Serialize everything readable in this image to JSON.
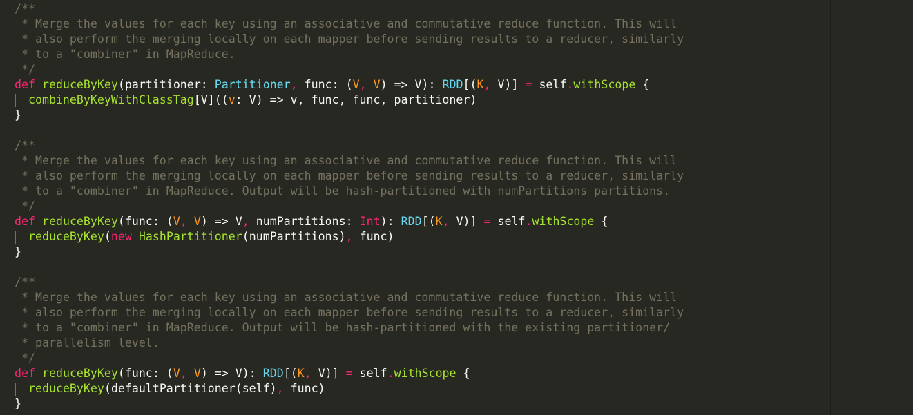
{
  "colors": {
    "background": "#272822",
    "keyword": "#f92672",
    "function": "#a6e22e",
    "type": "#66d9ef",
    "type_param": "#fd971f",
    "comment": "#75715e",
    "plain": "#f8f8f2"
  },
  "lines": [
    {
      "guide": false,
      "tokens": [
        {
          "c": "cm",
          "t": "/**"
        }
      ]
    },
    {
      "guide": false,
      "tokens": [
        {
          "c": "cm",
          "t": " * Merge the values for each key using an associative and commutative reduce function. This will"
        }
      ]
    },
    {
      "guide": false,
      "tokens": [
        {
          "c": "cm",
          "t": " * also perform the merging locally on each mapper before sending results to a reducer, similarly"
        }
      ]
    },
    {
      "guide": false,
      "tokens": [
        {
          "c": "cm",
          "t": " * to a \"combiner\" in MapReduce."
        }
      ]
    },
    {
      "guide": false,
      "tokens": [
        {
          "c": "cm",
          "t": " */"
        }
      ]
    },
    {
      "guide": false,
      "tokens": [
        {
          "c": "kw",
          "t": "def"
        },
        {
          "c": "pl",
          "t": " "
        },
        {
          "c": "fn",
          "t": "reduceByKey"
        },
        {
          "c": "pl",
          "t": "(partitioner: "
        },
        {
          "c": "ty",
          "t": "Partitioner"
        },
        {
          "c": "kw",
          "t": ","
        },
        {
          "c": "pl",
          "t": " func: ("
        },
        {
          "c": "tp",
          "t": "V"
        },
        {
          "c": "kw",
          "t": ","
        },
        {
          "c": "pl",
          "t": " "
        },
        {
          "c": "tp",
          "t": "V"
        },
        {
          "c": "pl",
          "t": ") => V): "
        },
        {
          "c": "ty",
          "t": "RDD"
        },
        {
          "c": "pl",
          "t": "[("
        },
        {
          "c": "tp",
          "t": "K"
        },
        {
          "c": "kw",
          "t": ","
        },
        {
          "c": "pl",
          "t": " V)] "
        },
        {
          "c": "kw",
          "t": "="
        },
        {
          "c": "pl",
          "t": " self"
        },
        {
          "c": "kw",
          "t": "."
        },
        {
          "c": "fn",
          "t": "withScope"
        },
        {
          "c": "pl",
          "t": " {"
        }
      ]
    },
    {
      "guide": true,
      "tokens": [
        {
          "c": "pl",
          "t": "  "
        },
        {
          "c": "fn",
          "t": "combineByKeyWithClassTag"
        },
        {
          "c": "pl",
          "t": "[V](("
        },
        {
          "c": "tp",
          "t": "v"
        },
        {
          "c": "pl",
          "t": ": V) => v, func, func, partitioner)"
        }
      ]
    },
    {
      "guide": false,
      "tokens": [
        {
          "c": "pl",
          "t": "}"
        }
      ]
    },
    {
      "guide": false,
      "tokens": [
        {
          "c": "pl",
          "t": ""
        }
      ]
    },
    {
      "guide": false,
      "tokens": [
        {
          "c": "cm",
          "t": "/**"
        }
      ]
    },
    {
      "guide": false,
      "tokens": [
        {
          "c": "cm",
          "t": " * Merge the values for each key using an associative and commutative reduce function. This will"
        }
      ]
    },
    {
      "guide": false,
      "tokens": [
        {
          "c": "cm",
          "t": " * also perform the merging locally on each mapper before sending results to a reducer, similarly"
        }
      ]
    },
    {
      "guide": false,
      "tokens": [
        {
          "c": "cm",
          "t": " * to a \"combiner\" in MapReduce. Output will be hash-partitioned with numPartitions partitions."
        }
      ]
    },
    {
      "guide": false,
      "tokens": [
        {
          "c": "cm",
          "t": " */"
        }
      ]
    },
    {
      "guide": false,
      "tokens": [
        {
          "c": "kw",
          "t": "def"
        },
        {
          "c": "pl",
          "t": " "
        },
        {
          "c": "fn",
          "t": "reduceByKey"
        },
        {
          "c": "pl",
          "t": "(func: ("
        },
        {
          "c": "tp",
          "t": "V"
        },
        {
          "c": "kw",
          "t": ","
        },
        {
          "c": "pl",
          "t": " "
        },
        {
          "c": "tp",
          "t": "V"
        },
        {
          "c": "pl",
          "t": ") => V"
        },
        {
          "c": "kw",
          "t": ","
        },
        {
          "c": "pl",
          "t": " numPartitions: "
        },
        {
          "c": "kw",
          "t": "Int"
        },
        {
          "c": "pl",
          "t": "): "
        },
        {
          "c": "ty",
          "t": "RDD"
        },
        {
          "c": "pl",
          "t": "[("
        },
        {
          "c": "tp",
          "t": "K"
        },
        {
          "c": "kw",
          "t": ","
        },
        {
          "c": "pl",
          "t": " V)] "
        },
        {
          "c": "kw",
          "t": "="
        },
        {
          "c": "pl",
          "t": " self"
        },
        {
          "c": "kw",
          "t": "."
        },
        {
          "c": "fn",
          "t": "withScope"
        },
        {
          "c": "pl",
          "t": " {"
        }
      ]
    },
    {
      "guide": true,
      "tokens": [
        {
          "c": "pl",
          "t": "  "
        },
        {
          "c": "fn",
          "t": "reduceByKey"
        },
        {
          "c": "pl",
          "t": "("
        },
        {
          "c": "kw",
          "t": "new"
        },
        {
          "c": "pl",
          "t": " "
        },
        {
          "c": "fn",
          "t": "HashPartitioner"
        },
        {
          "c": "pl",
          "t": "(numPartitions)"
        },
        {
          "c": "kw",
          "t": ","
        },
        {
          "c": "pl",
          "t": " func)"
        }
      ]
    },
    {
      "guide": false,
      "tokens": [
        {
          "c": "pl",
          "t": "}"
        }
      ]
    },
    {
      "guide": false,
      "tokens": [
        {
          "c": "pl",
          "t": ""
        }
      ]
    },
    {
      "guide": false,
      "tokens": [
        {
          "c": "cm",
          "t": "/**"
        }
      ]
    },
    {
      "guide": false,
      "tokens": [
        {
          "c": "cm",
          "t": " * Merge the values for each key using an associative and commutative reduce function. This will"
        }
      ]
    },
    {
      "guide": false,
      "tokens": [
        {
          "c": "cm",
          "t": " * also perform the merging locally on each mapper before sending results to a reducer, similarly"
        }
      ]
    },
    {
      "guide": false,
      "tokens": [
        {
          "c": "cm",
          "t": " * to a \"combiner\" in MapReduce. Output will be hash-partitioned with the existing partitioner/"
        }
      ]
    },
    {
      "guide": false,
      "tokens": [
        {
          "c": "cm",
          "t": " * parallelism level."
        }
      ]
    },
    {
      "guide": false,
      "tokens": [
        {
          "c": "cm",
          "t": " */"
        }
      ]
    },
    {
      "guide": false,
      "tokens": [
        {
          "c": "kw",
          "t": "def"
        },
        {
          "c": "pl",
          "t": " "
        },
        {
          "c": "fn",
          "t": "reduceByKey"
        },
        {
          "c": "pl",
          "t": "(func: ("
        },
        {
          "c": "tp",
          "t": "V"
        },
        {
          "c": "kw",
          "t": ","
        },
        {
          "c": "pl",
          "t": " "
        },
        {
          "c": "tp",
          "t": "V"
        },
        {
          "c": "pl",
          "t": ") => V): "
        },
        {
          "c": "ty",
          "t": "RDD"
        },
        {
          "c": "pl",
          "t": "[("
        },
        {
          "c": "tp",
          "t": "K"
        },
        {
          "c": "kw",
          "t": ","
        },
        {
          "c": "pl",
          "t": " V)] "
        },
        {
          "c": "kw",
          "t": "="
        },
        {
          "c": "pl",
          "t": " self"
        },
        {
          "c": "kw",
          "t": "."
        },
        {
          "c": "fn",
          "t": "withScope"
        },
        {
          "c": "pl",
          "t": " {"
        }
      ]
    },
    {
      "guide": true,
      "tokens": [
        {
          "c": "pl",
          "t": "  "
        },
        {
          "c": "fn",
          "t": "reduceByKey"
        },
        {
          "c": "pl",
          "t": "(defaultPartitioner(self)"
        },
        {
          "c": "kw",
          "t": ","
        },
        {
          "c": "pl",
          "t": " func)"
        }
      ]
    },
    {
      "guide": false,
      "tokens": [
        {
          "c": "pl",
          "t": "}"
        }
      ]
    }
  ]
}
